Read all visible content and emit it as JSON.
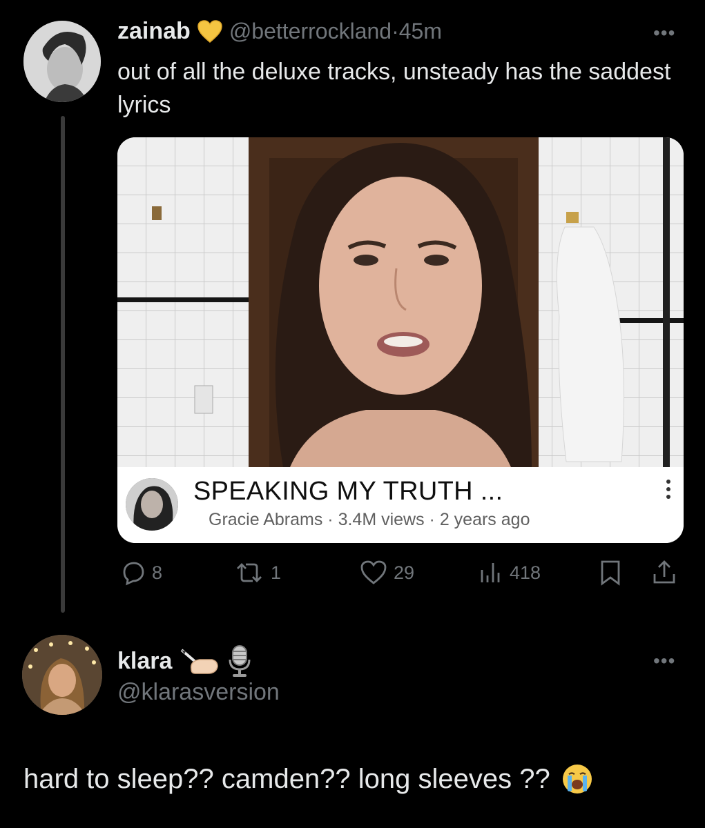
{
  "tweet": {
    "author": {
      "display_name": "zainab",
      "badge_icon": "yellow-heart-emoji",
      "handle": "@betterrockland",
      "separator": " · ",
      "time": "45m"
    },
    "text": "out of all the deluxe tracks, unsteady has the saddest lyrics",
    "embed": {
      "title": "SPEAKING MY TRUTH ...",
      "channel": "Gracie Abrams",
      "meta_sep": " · ",
      "views": "3.4M views",
      "age": "2 years ago"
    },
    "actions": {
      "replies": "8",
      "reposts": "1",
      "likes": "29",
      "views": "418"
    }
  },
  "reply": {
    "author": {
      "display_name": "klara",
      "emoji_icons": [
        "writing-hand-emoji",
        "microphone-emoji"
      ],
      "handle": "@klarasversion"
    },
    "text": "hard to sleep?? camden?? long sleeves ??",
    "trailing_emoji": "loudly-crying-face-emoji"
  },
  "colors": {
    "background": "#000000",
    "text": "#e7e9ea",
    "muted": "#71767b",
    "heart_badge": "#f5c542",
    "card_bg": "#ffffff"
  }
}
